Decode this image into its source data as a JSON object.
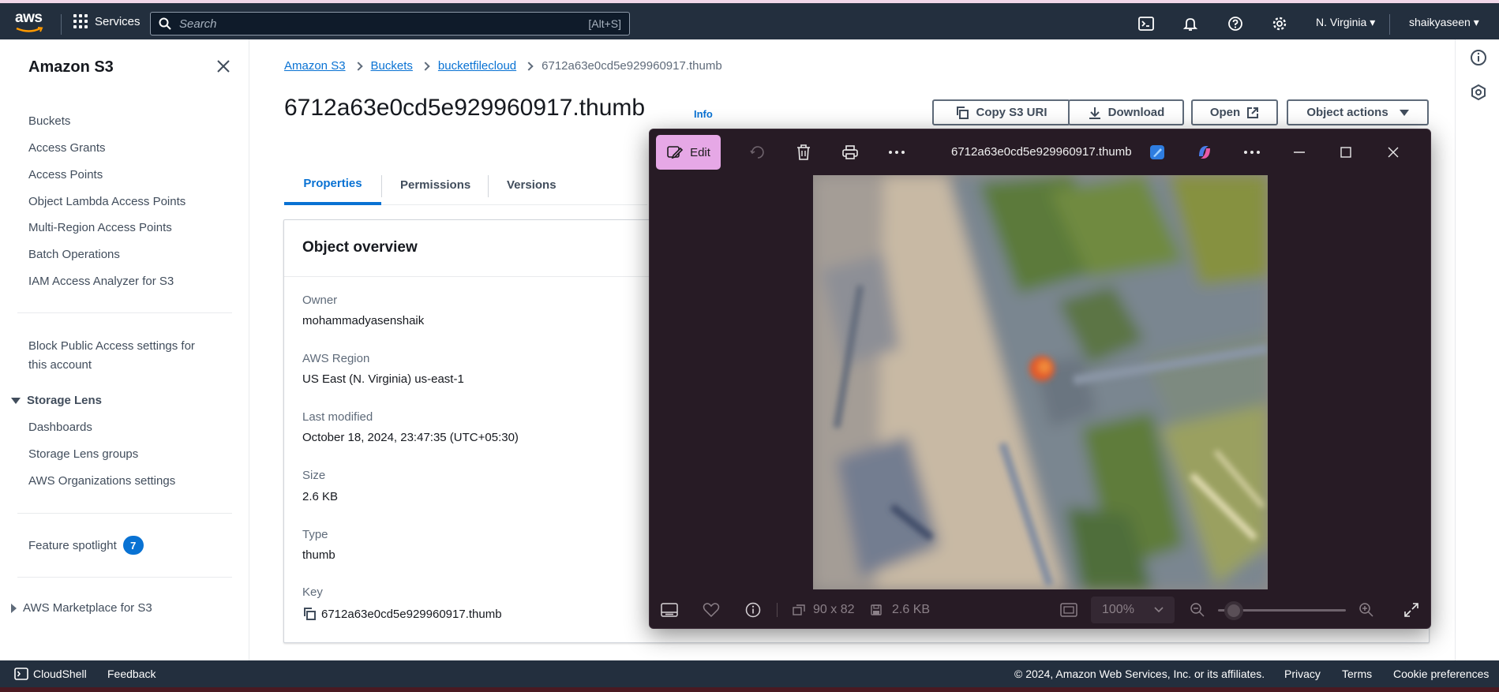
{
  "topnav": {
    "logo_text": "aws",
    "services_label": "Services",
    "search_placeholder": "Search",
    "search_shortcut": "[Alt+S]",
    "region": "N. Virginia",
    "user": "shaikyaseen"
  },
  "sidebar": {
    "title": "Amazon S3",
    "items": [
      {
        "label": "Buckets"
      },
      {
        "label": "Access Grants"
      },
      {
        "label": "Access Points"
      },
      {
        "label": "Object Lambda Access Points"
      },
      {
        "label": "Multi-Region Access Points"
      },
      {
        "label": "Batch Operations"
      },
      {
        "label": "IAM Access Analyzer for S3"
      }
    ],
    "block_public_line1": "Block Public Access settings for",
    "block_public_line2": "this account",
    "storage_lens": {
      "label": "Storage Lens",
      "items": [
        {
          "label": "Dashboards"
        },
        {
          "label": "Storage Lens groups"
        },
        {
          "label": "AWS Organizations settings"
        }
      ]
    },
    "feature_spotlight": {
      "label": "Feature spotlight",
      "count": "7"
    },
    "marketplace": "AWS Marketplace for S3"
  },
  "breadcrumb": {
    "items": [
      "Amazon S3",
      "Buckets",
      "bucketfilecloud"
    ],
    "current": "6712a63e0cd5e929960917.thumb"
  },
  "page": {
    "title": "6712a63e0cd5e929960917.thumb",
    "info": "Info"
  },
  "actions": {
    "copy_uri": "Copy S3 URI",
    "download": "Download",
    "open": "Open",
    "object_actions": "Object actions"
  },
  "tabs": [
    {
      "label": "Properties",
      "active": true
    },
    {
      "label": "Permissions",
      "active": false
    },
    {
      "label": "Versions",
      "active": false
    }
  ],
  "overview": {
    "title": "Object overview",
    "owner_label": "Owner",
    "owner_value": "mohammadyasenshaik",
    "region_label": "AWS Region",
    "region_value": "US East (N. Virginia) us-east-1",
    "modified_label": "Last modified",
    "modified_value": "October 18, 2024, 23:47:35 (UTC+05:30)",
    "size_label": "Size",
    "size_value": "2.6 KB",
    "type_label": "Type",
    "type_value": "thumb",
    "key_label": "Key",
    "key_value": "6712a63e0cd5e929960917.thumb"
  },
  "viewer": {
    "edit_label": "Edit",
    "title": "6712a63e0cd5e929960917.thumb",
    "dimensions": "90 x 82",
    "file_size": "2.6 KB",
    "zoom": "100%",
    "zoom_level": 0.06
  },
  "footer": {
    "cloudshell": "CloudShell",
    "feedback": "Feedback",
    "copyright": "© 2024, Amazon Web Services, Inc. or its affiliates.",
    "privacy": "Privacy",
    "terms": "Terms",
    "cookies": "Cookie preferences"
  },
  "colors": {
    "nav_bg": "#232f3e",
    "link": "#0972d3",
    "viewer_bg": "#271b25",
    "edit_accent": "#e6a8e6"
  }
}
